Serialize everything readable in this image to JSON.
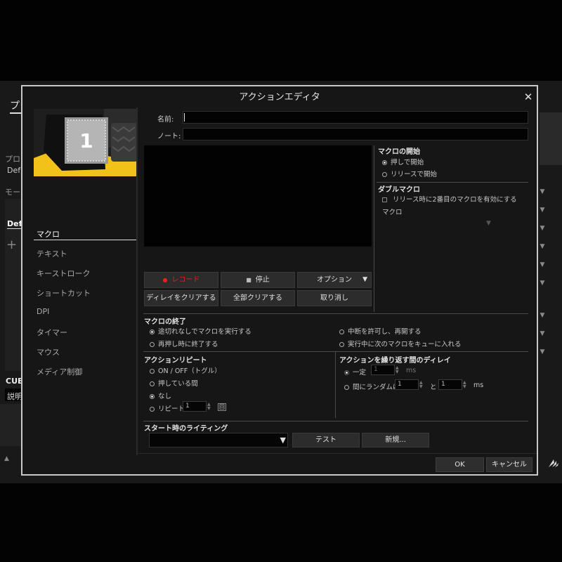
{
  "background": {
    "tab_fragment": "プロ",
    "label_profile": "プロフ",
    "profile_value": "Def",
    "label_mode": "モード",
    "list_value": "Def",
    "add_glyph": "+",
    "cue_label": "CUE",
    "desc_label": "説明",
    "scroll_up_glyph": "▲",
    "chevrons": [
      "▼",
      "▼",
      "▼",
      "▼",
      "▼",
      "▼",
      "▼",
      "▼",
      "▼"
    ]
  },
  "dialog": {
    "title": "アクションエディタ",
    "close_glyph": "✕",
    "key_number": "1"
  },
  "sidebar": {
    "items": [
      {
        "label": "マクロ",
        "active": true
      },
      {
        "label": "テキスト"
      },
      {
        "label": "キーストローク"
      },
      {
        "label": "ショートカット"
      },
      {
        "label": "DPI"
      },
      {
        "label": "タイマー"
      },
      {
        "label": "マウス"
      },
      {
        "label": "メディア制御"
      }
    ]
  },
  "form": {
    "name_label": "名前:",
    "name_value": "",
    "note_label": "ノート:",
    "note_value": ""
  },
  "record_buttons": {
    "record_label": "レコード",
    "record_glyph": "●",
    "stop_label": "停止",
    "stop_glyph": "■",
    "options_label": "オプション",
    "options_glyph": "▼",
    "clear_delay_label": "ディレイをクリアする",
    "clear_all_label": "全部クリアする",
    "undo_label": "取り消し"
  },
  "macro_start": {
    "title": "マクロの開始",
    "options": [
      "押しで開始",
      "リリースで開始"
    ],
    "selected": 0
  },
  "double_macro": {
    "title": "ダブルマクロ",
    "checkbox_label": "リリース時に2番目のマクロを有効にする",
    "macro_label": "マクロ",
    "dropdown_glyph": "▼"
  },
  "macro_end": {
    "title": "マクロの終了",
    "options": [
      "途切れなしでマクロを実行する",
      "再押し時に終了する",
      "中断を許可し、再開する",
      "実行中に次のマクロをキューに入れる"
    ],
    "selected": 0
  },
  "action_repeat": {
    "title": "アクションリピート",
    "options": [
      "ON / OFF（トグル）",
      "押している間",
      "なし",
      "リピート"
    ],
    "selected": 2,
    "repeat_value": "1",
    "repeat_unit": "回"
  },
  "repeat_delay": {
    "title": "アクションを繰り返す間のディレイ",
    "fixed_label": "一定",
    "fixed_value": "1",
    "fixed_unit": "ms",
    "random_label": "間にランダムに",
    "random_min": "1",
    "and_label": "と",
    "random_max": "1",
    "random_unit": "ms"
  },
  "start_lighting": {
    "title": "スタート時のライティング",
    "select_value": "",
    "dropdown_glyph": "▼",
    "test_label": "テスト",
    "new_label": "新規..."
  },
  "footer": {
    "ok_label": "OK",
    "cancel_label": "キャンセル"
  },
  "colors": {
    "record_red": "#e0241b",
    "accent_yellow": "#f3c21a"
  }
}
